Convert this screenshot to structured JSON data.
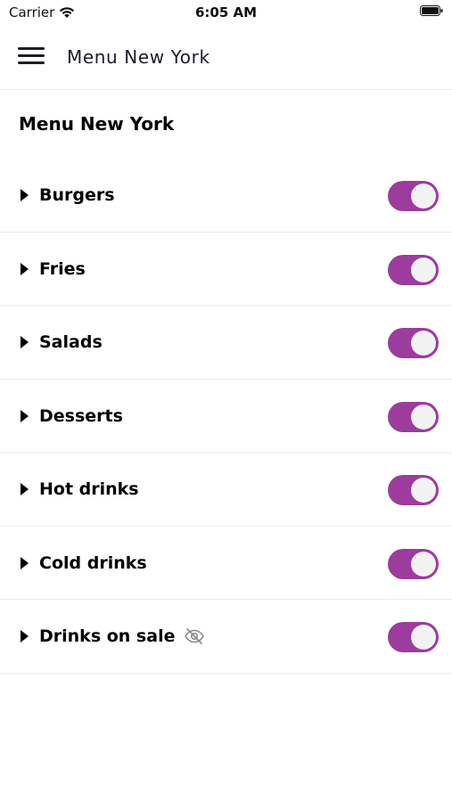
{
  "status_bar": {
    "carrier": "Carrier",
    "time": "6:05 AM"
  },
  "header": {
    "title": "Menu New York"
  },
  "page": {
    "title": "Menu New York"
  },
  "colors": {
    "accent": "#9c3c9c",
    "knob": "#f2f2f2",
    "divider": "#ececec"
  },
  "categories": [
    {
      "label": "Burgers",
      "enabled": true,
      "hidden": false
    },
    {
      "label": "Fries",
      "enabled": true,
      "hidden": false
    },
    {
      "label": "Salads",
      "enabled": true,
      "hidden": false
    },
    {
      "label": "Desserts",
      "enabled": true,
      "hidden": false
    },
    {
      "label": "Hot drinks",
      "enabled": true,
      "hidden": false
    },
    {
      "label": "Cold drinks",
      "enabled": true,
      "hidden": false
    },
    {
      "label": "Drinks on sale",
      "enabled": true,
      "hidden": true
    }
  ]
}
